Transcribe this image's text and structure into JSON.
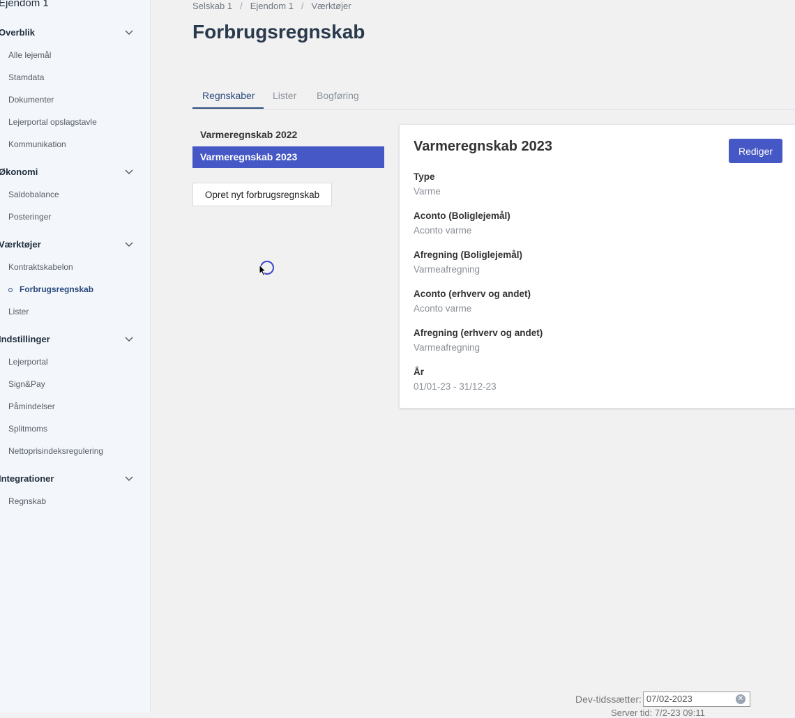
{
  "sidebar": {
    "title": "Ejendom 1",
    "sections": [
      {
        "label": "Overblik",
        "items": [
          "Alle lejemål",
          "Stamdata",
          "Dokumenter",
          "Lejerportal opslagstavle",
          "Kommunikation"
        ]
      },
      {
        "label": "Økonomi",
        "items": [
          "Saldobalance",
          "Posteringer"
        ]
      },
      {
        "label": "Værktøjer",
        "items": [
          "Kontraktskabelon",
          "Forbrugsregnskab",
          "Lister"
        ]
      },
      {
        "label": "Indstillinger",
        "items": [
          "Lejerportal",
          "Sign&Pay",
          "Påmindelser",
          "Splitmoms",
          "Nettoprisindeksregulering"
        ]
      },
      {
        "label": "Integrationer",
        "items": [
          "Regnskab"
        ]
      }
    ],
    "active_item": "Forbrugsregnskab"
  },
  "breadcrumb": [
    "Selskab 1",
    "Ejendom 1",
    "Værktøjer"
  ],
  "page_title": "Forbrugsregnskab",
  "tabs": [
    "Regnskaber",
    "Lister",
    "Bogføring"
  ],
  "active_tab": "Regnskaber",
  "accounts": [
    "Varmeregnskab 2022",
    "Varmeregnskab 2023"
  ],
  "selected_account": "Varmeregnskab 2023",
  "new_button": "Opret nyt forbrugsregnskab",
  "detail": {
    "title": "Varmeregnskab 2023",
    "edit_button": "Rediger",
    "fields": [
      {
        "label": "Type",
        "value": "Varme"
      },
      {
        "label": "Aconto (Boliglejemål)",
        "value": "Aconto varme"
      },
      {
        "label": "Afregning (Boliglejemål)",
        "value": "Varmeafregning"
      },
      {
        "label": "Aconto (erhverv og andet)",
        "value": "Aconto varme"
      },
      {
        "label": "Afregning (erhverv og andet)",
        "value": "Varmeafregning"
      },
      {
        "label": "År",
        "value": "01/01-23 - 31/12-23"
      }
    ]
  },
  "dev": {
    "label": "Dev-tidssætter:",
    "value": "07/02-2023",
    "sub": "Server tid: 7/2-23 09:11"
  },
  "colors": {
    "accent": "#4658c6",
    "nav_active": "#2b4a7e"
  }
}
